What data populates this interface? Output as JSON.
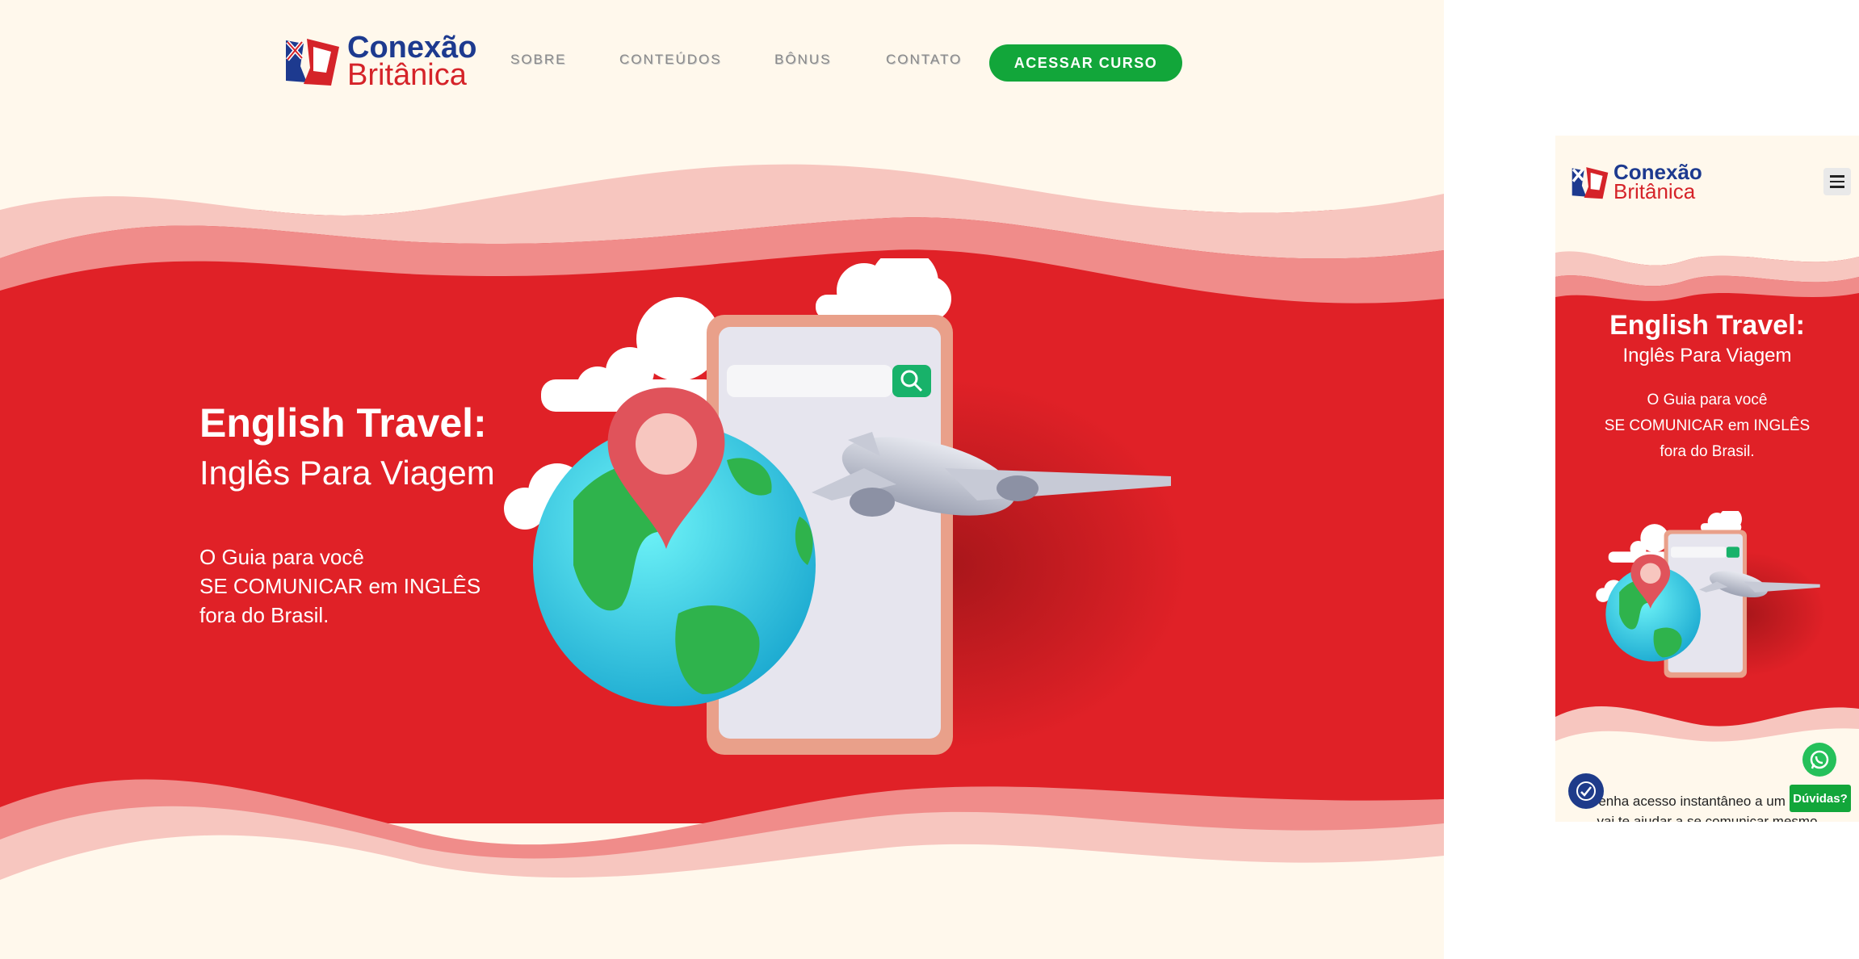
{
  "desktop": {
    "logo": {
      "line1": "Conexão",
      "line2": "Britânica"
    },
    "nav": [
      {
        "label": "SOBRE"
      },
      {
        "label": "CONTEÚDOS"
      },
      {
        "label": "BÔNUS"
      },
      {
        "label": "CONTATO"
      }
    ],
    "cta": "ACESSAR CURSO",
    "hero": {
      "title": "English Travel:",
      "subtitle": "Inglês Para Viagem",
      "lead_1": "O Guia para você",
      "lead_2": "SE COMUNICAR em INGLÊS",
      "lead_3": "fora do Brasil."
    },
    "colors": {
      "red": "#e02127",
      "cream": "#fff8ec",
      "green": "#12a63a",
      "navy": "#1d3a8f"
    }
  },
  "mobile": {
    "logo": {
      "line1": "Conexão",
      "line2": "Britânica"
    },
    "menu_icon": "hamburger-icon",
    "hero": {
      "title": "English Travel:",
      "subtitle": "Inglês Para Viagem",
      "lead_1": "O Guia para você",
      "lead_2": "SE COMUNICAR em INGLÊS",
      "lead_3": "fora do Brasil."
    },
    "body_line_1": "Tenha acesso instantâneo a um curso",
    "body_line_2": "vai te ajudar a se comunicar mesmo",
    "whatsapp_icon": "whatsapp-icon",
    "help_button": "Dúvidas?",
    "accessibility_icon": "accessibility-icon"
  }
}
